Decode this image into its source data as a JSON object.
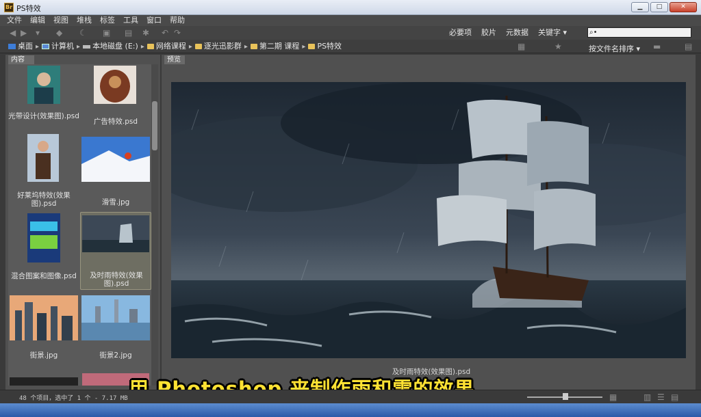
{
  "window": {
    "title": "PS特效",
    "logo": "Br"
  },
  "menu": [
    "文件",
    "编辑",
    "视图",
    "堆栈",
    "标签",
    "工具",
    "窗口",
    "帮助"
  ],
  "workspaces": [
    "必要项",
    "胶片",
    "元数据",
    "关键字 ▾"
  ],
  "search": {
    "placeholder": ""
  },
  "breadcrumb": [
    "桌面",
    "计算机",
    "本地磁盘 (E:)",
    "网络课程",
    "逐光迅影群",
    "第二期 课程",
    "PS特效"
  ],
  "sort_label": "按文件名排序 ▾",
  "panels": {
    "left_tab": "内容",
    "right_tab": "预览"
  },
  "thumbnails": [
    {
      "label": "光带设计(效果图).psd"
    },
    {
      "label": "广告特效.psd"
    },
    {
      "label": "好莱坞特效(效果图).psd"
    },
    {
      "label": "滑雪.jpg"
    },
    {
      "label": "混合图案和图像.psd"
    },
    {
      "label": "及时雨特效(效果图).psd",
      "selected": true
    },
    {
      "label": "街景.jpg"
    },
    {
      "label": "街景2.jpg"
    }
  ],
  "preview": {
    "caption": "及时雨特效(效果图).psd"
  },
  "status": "48 个项目，选中了 1 个 - 7.17 MB",
  "subtitle": "用 Photoshop 来制作雨和雪的效果",
  "colors": {
    "subtitle": "#ffe233",
    "panel": "#505050",
    "selection": "#6e6e62"
  }
}
